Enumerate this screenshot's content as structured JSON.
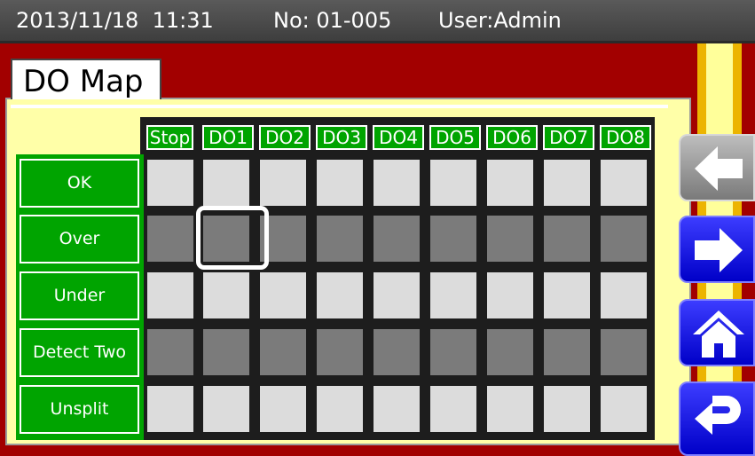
{
  "status_bar": {
    "datetime": "2013/11/18  11:31",
    "no": "No: 01-005",
    "user": "User:Admin"
  },
  "tab": {
    "title": "DO Map"
  },
  "columns": [
    "Stop",
    "DO1",
    "DO2",
    "DO3",
    "DO4",
    "DO5",
    "DO6",
    "DO7",
    "DO8"
  ],
  "rows": [
    {
      "label": "OK",
      "active": false
    },
    {
      "label": "Over",
      "active": true
    },
    {
      "label": "Under",
      "active": false
    },
    {
      "label": "Detect Two",
      "active": true
    },
    {
      "label": "Unsplit",
      "active": false
    }
  ],
  "selected_cell": {
    "row": "Over",
    "column": "DO1"
  },
  "colors": {
    "background": "#a20000",
    "panel": "#ffffa8",
    "header_green": "#00a400",
    "cell_off": "#dcdcdc",
    "cell_on": "#7b7b7b",
    "nav_blue": "#0000c8"
  },
  "nav": {
    "back_icon": "arrow-left-icon",
    "next_icon": "arrow-right-icon",
    "home_icon": "home-icon",
    "return_icon": "return-icon"
  }
}
